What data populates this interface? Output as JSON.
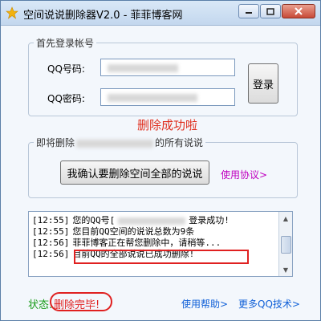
{
  "window": {
    "title": "空间说说删除器V2.0 - 菲菲博客网",
    "icon": "app-icon",
    "controls": [
      "minimize-icon",
      "restore-icon",
      "close-icon"
    ]
  },
  "login": {
    "legend": "首先登录帐号",
    "qq_label": "QQ号码:",
    "pwd_label": "QQ密码:",
    "login_button": "登录"
  },
  "notice": {
    "success_text": "删除成功啦",
    "color": "#e03020"
  },
  "delete": {
    "legend_prefix": "即将删除",
    "legend_suffix": "的所有说说",
    "confirm_button": "我确认要删除空间全部的说说",
    "agreement_link": "使用协议>"
  },
  "log": {
    "lines": [
      {
        "time": "[12:55]",
        "text": "您的QQ号[",
        "text_after": "登录成功!"
      },
      {
        "time": "[12:55]",
        "text": "您目前QQ空间的说说总数为9条",
        "text_after": ""
      },
      {
        "time": "[12:56]",
        "text": "菲菲博客正在帮您删除中，请稍等...",
        "text_after": ""
      },
      {
        "time": "[12:56]",
        "text": "目前QQ的全部说说已成功删除!",
        "text_after": ""
      }
    ]
  },
  "status": {
    "label": "状态:",
    "value": "删除完毕!",
    "label_color": "#1a9c1a",
    "value_color": "#e02020"
  },
  "footer": {
    "help_link": "使用帮助>",
    "more_link": "更多QQ技术>"
  }
}
